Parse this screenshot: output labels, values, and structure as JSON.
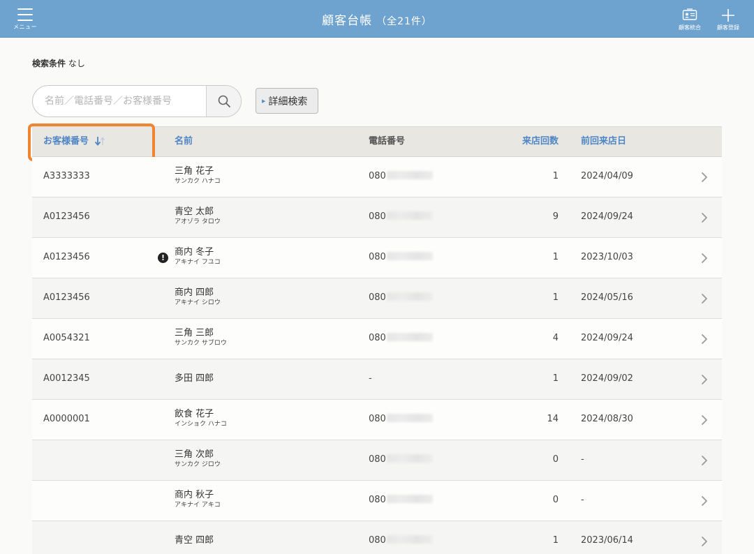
{
  "header": {
    "menu_label": "メニュー",
    "title": "顧客台帳",
    "count": "（全21件）",
    "merge_label": "顧客統合",
    "add_label": "顧客登録",
    "bg_color": "#6fa3cf"
  },
  "search": {
    "condition_label": "検索条件",
    "condition_value": "なし",
    "placeholder": "名前／電話番号／お客様番号",
    "advanced_label": "詳細検索"
  },
  "table": {
    "headers": {
      "customer_no": "お客様番号",
      "name": "名前",
      "phone": "電話番号",
      "visits": "来店回数",
      "last_visit": "前回来店日"
    },
    "highlight_color": "#ef8532",
    "rows": [
      {
        "no": "A3333333",
        "name": "三角 花子",
        "kana": "サンカク ハナコ",
        "phone": "080",
        "visits": "1",
        "last": "2024/04/09",
        "alert": ""
      },
      {
        "no": "A0123456",
        "name": "青空 太郎",
        "kana": "アオゾラ タロウ",
        "phone": "080",
        "visits": "9",
        "last": "2024/09/24",
        "alert": ""
      },
      {
        "no": "A0123456",
        "name": "商内 冬子",
        "kana": "アキナイ フユコ",
        "phone": "080",
        "visits": "1",
        "last": "2023/10/03",
        "alert": "!"
      },
      {
        "no": "A0123456",
        "name": "商内 四郎",
        "kana": "アキナイ シロウ",
        "phone": "080",
        "visits": "1",
        "last": "2024/05/16",
        "alert": ""
      },
      {
        "no": "A0054321",
        "name": "三角 三郎",
        "kana": "サンカク サブロウ",
        "phone": "080",
        "visits": "4",
        "last": "2024/09/24",
        "alert": ""
      },
      {
        "no": "A0012345",
        "name": "多田 四郎",
        "kana": "",
        "phone": "-",
        "visits": "1",
        "last": "2024/09/02",
        "alert": ""
      },
      {
        "no": "A0000001",
        "name": "飲食 花子",
        "kana": "インショク ハナコ",
        "phone": "080",
        "visits": "14",
        "last": "2024/08/30",
        "alert": ""
      },
      {
        "no": "",
        "name": "三角 次郎",
        "kana": "サンカク ジロウ",
        "phone": "080",
        "visits": "0",
        "last": "-",
        "alert": ""
      },
      {
        "no": "",
        "name": "商内 秋子",
        "kana": "アキナイ アキコ",
        "phone": "080",
        "visits": "0",
        "last": "-",
        "alert": ""
      },
      {
        "no": "",
        "name": "青空 四郎",
        "kana": "",
        "phone": "080",
        "visits": "1",
        "last": "2023/06/14",
        "alert": ""
      }
    ]
  }
}
